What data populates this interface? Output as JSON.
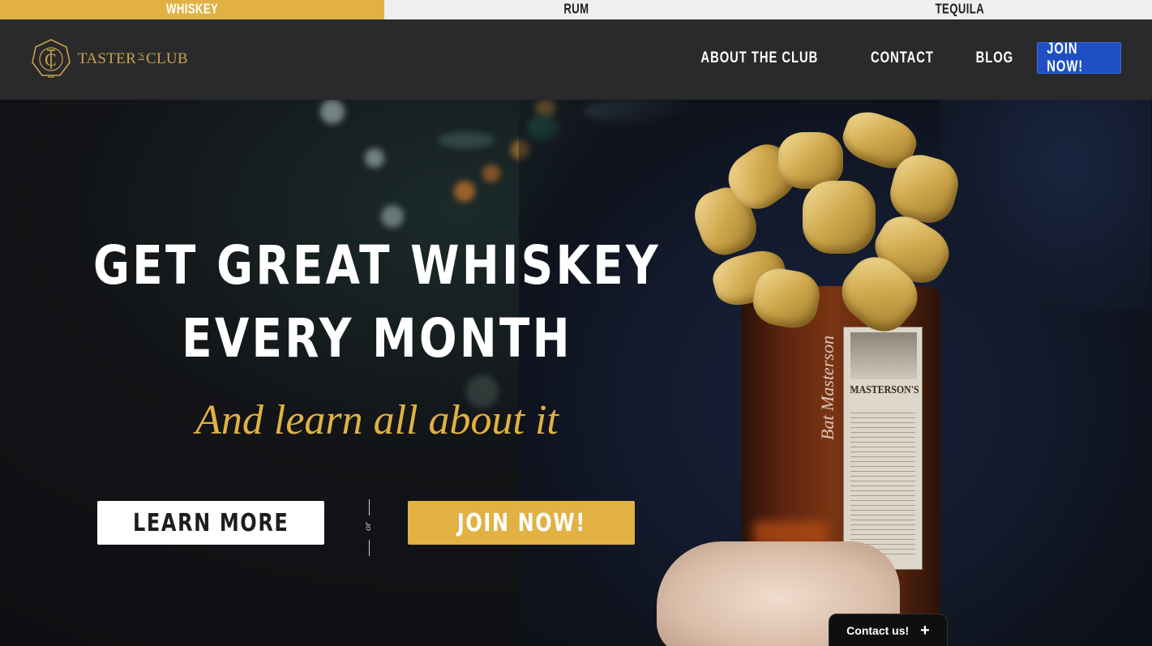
{
  "spirit_tabs": [
    {
      "label": "WHISKEY",
      "active": true
    },
    {
      "label": "RUM",
      "active": false
    },
    {
      "label": "TEQUILA",
      "active": false
    }
  ],
  "header": {
    "logo_text_1": "TASTER",
    "logo_sup": "'S",
    "logo_text_2": "CLUB",
    "nav": {
      "about": "ABOUT THE CLUB",
      "contact": "CONTACT",
      "blog": "BLOG",
      "join": "JOIN NOW!"
    }
  },
  "hero": {
    "title_line_1": "GET GREAT WHISKEY",
    "title_line_2": "EVERY MONTH",
    "subtitle": "And learn all about it",
    "learn_more": "LEARN MORE",
    "or": "or",
    "join_now": "JOIN NOW!",
    "bottle_brand": "MASTERSON'S",
    "signature": "Bat Masterson"
  },
  "contact_widget": {
    "label": "Contact us!",
    "icon": "plus-icon"
  },
  "colors": {
    "gold": "#e1b143",
    "header_bg": "#2a2a2c",
    "nav_join_bg": "#1f4fc2"
  }
}
